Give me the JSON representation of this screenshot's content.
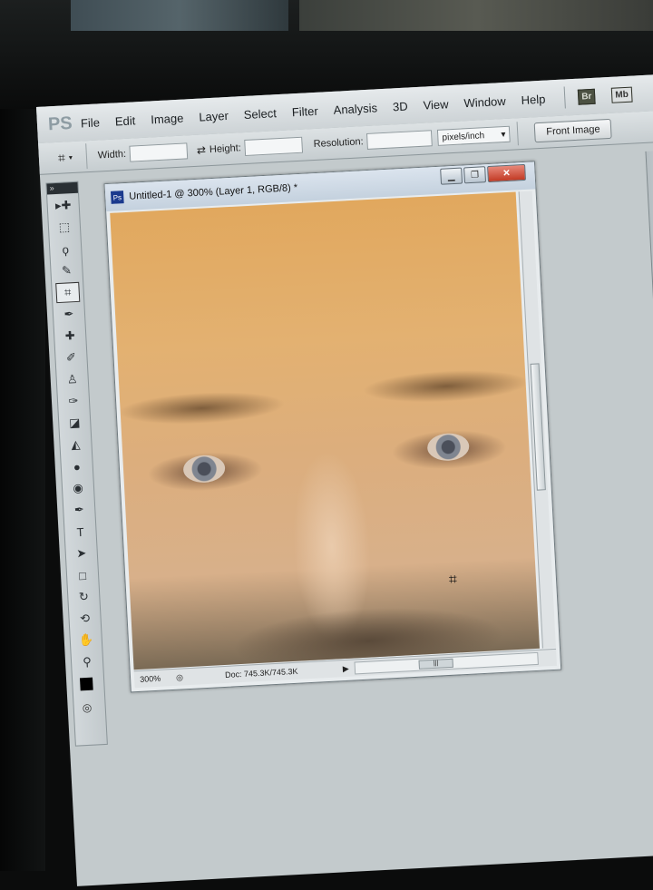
{
  "app": {
    "logo": "PS",
    "menus": [
      "File",
      "Edit",
      "Image",
      "Layer",
      "Select",
      "Filter",
      "Analysis",
      "3D",
      "View",
      "Window",
      "Help"
    ],
    "badges": [
      "Br",
      "Mb"
    ]
  },
  "options": {
    "width_label": "Width:",
    "height_label": "Height:",
    "resolution_label": "Resolution:",
    "units": "pixels/inch",
    "front_image_button": "Front Image"
  },
  "toolbox": {
    "collapse": "»",
    "tools": [
      {
        "name": "move-tool-icon",
        "glyph": "▸✚"
      },
      {
        "name": "marquee-tool-icon",
        "glyph": "⬚"
      },
      {
        "name": "lasso-tool-icon",
        "glyph": "ϙ"
      },
      {
        "name": "quick-selection-tool-icon",
        "glyph": "✎"
      },
      {
        "name": "crop-tool-icon",
        "glyph": "⌗",
        "active": true
      },
      {
        "name": "eyedropper-tool-icon",
        "glyph": "✒"
      },
      {
        "name": "healing-brush-tool-icon",
        "glyph": "✚"
      },
      {
        "name": "brush-tool-icon",
        "glyph": "✐"
      },
      {
        "name": "clone-stamp-tool-icon",
        "glyph": "♙"
      },
      {
        "name": "history-brush-tool-icon",
        "glyph": "✑"
      },
      {
        "name": "eraser-tool-icon",
        "glyph": "◪"
      },
      {
        "name": "paint-bucket-tool-icon",
        "glyph": "◭"
      },
      {
        "name": "blur-tool-icon",
        "glyph": "●"
      },
      {
        "name": "dodge-tool-icon",
        "glyph": "◉"
      },
      {
        "name": "pen-tool-icon",
        "glyph": "✒"
      },
      {
        "name": "type-tool-icon",
        "glyph": "T"
      },
      {
        "name": "path-selection-tool-icon",
        "glyph": "➤"
      },
      {
        "name": "shape-tool-icon",
        "glyph": "□"
      },
      {
        "name": "3d-rotate-tool-icon",
        "glyph": "↻"
      },
      {
        "name": "3d-orbit-tool-icon",
        "glyph": "⟲"
      },
      {
        "name": "hand-tool-icon",
        "glyph": "✋"
      },
      {
        "name": "zoom-tool-icon",
        "glyph": "⚲"
      }
    ],
    "quick_mask": "◎"
  },
  "document": {
    "title": "Untitled-1 @ 300% (Layer 1, RGB/8) *",
    "zoom": "300%",
    "doc_size": "Doc: 745.3K/745.3K"
  }
}
